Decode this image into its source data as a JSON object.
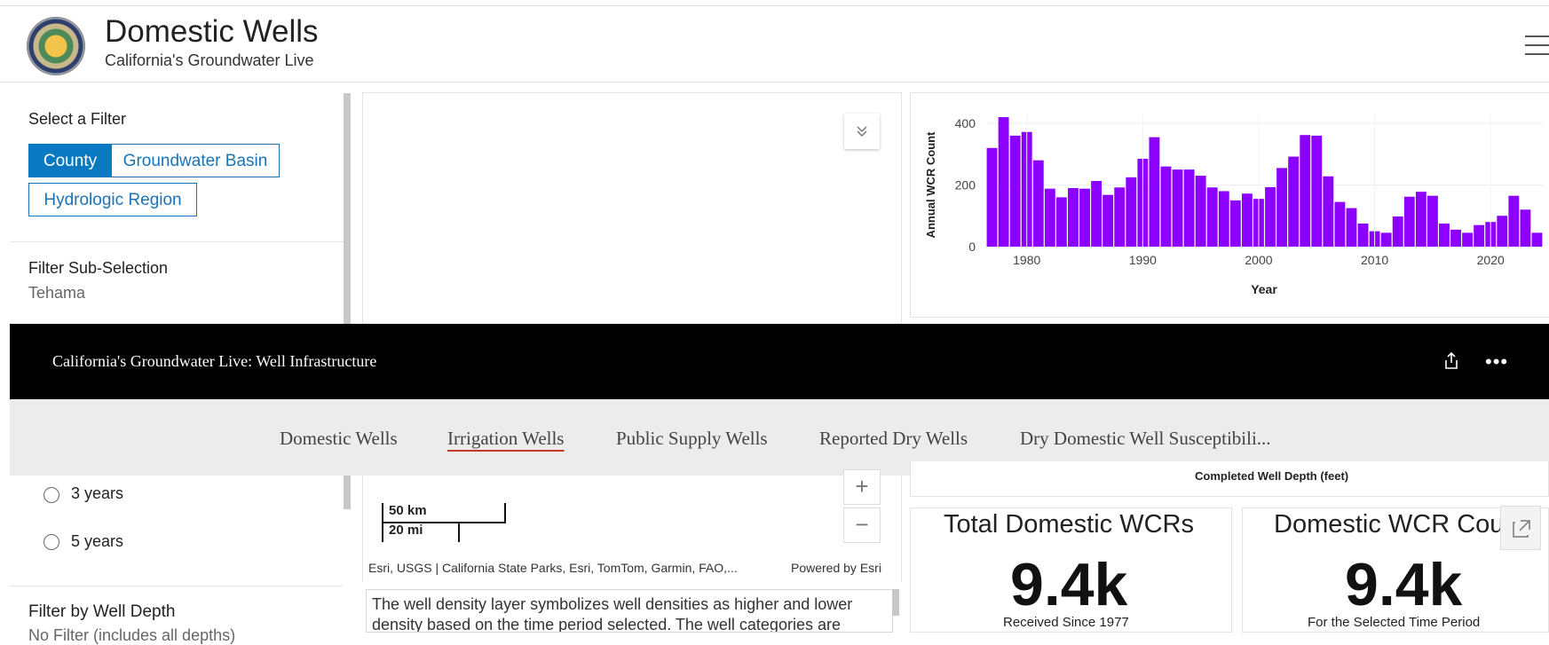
{
  "header": {
    "title": "Domestic Wells",
    "subtitle": "California's Groundwater Live"
  },
  "filter": {
    "label": "Select a Filter",
    "buttons": [
      "County",
      "Groundwater Basin",
      "Hydrologic Region"
    ],
    "active": "County",
    "subselection_label": "Filter Sub-Selection",
    "subselection_value": "Tehama"
  },
  "time_options": [
    "3 years",
    "5 years"
  ],
  "depth_filter": {
    "label": "Filter by Well Depth",
    "value": "No Filter (includes all depths)"
  },
  "app_bar": {
    "title": "California's Groundwater Live: Well Infrastructure"
  },
  "tabs": [
    {
      "label": "Domestic Wells"
    },
    {
      "label": "Irrigation Wells"
    },
    {
      "label": "Public Supply Wells"
    },
    {
      "label": "Reported Dry Wells"
    },
    {
      "label": "Dry Domestic Well Susceptibili..."
    }
  ],
  "active_tab": "Irrigation Wells",
  "map": {
    "scale_km": "50 km",
    "scale_mi": "20 mi",
    "attribution": "Esri, USGS | California State Parks, Esri, TomTom, Garmin, FAO,...",
    "powered_by": "Powered by Esri",
    "description": "The well density layer symbolizes well densities as higher and lower density based on the time period selected. The well categories are"
  },
  "depth_chart_axis_title": "Completed Well Depth (feet)",
  "cards": [
    {
      "title": "Total Domestic WCRs",
      "value": "9.4k",
      "subtitle": "Received Since 1977"
    },
    {
      "title": "Domestic WCR Cou",
      "value": "9.4k",
      "subtitle": "For the Selected Time Period"
    }
  ],
  "colors": {
    "accent": "#0b79c1",
    "bar": "#8b00ff",
    "tab_underline": "#c0392b"
  },
  "chart_data": {
    "type": "bar",
    "xlabel": "Year",
    "ylabel": "Annual WCR Count",
    "ylim": [
      0,
      400
    ],
    "xticks": [
      1980,
      1990,
      2000,
      2010,
      2020
    ],
    "yticks": [
      0,
      200,
      400
    ],
    "grid": true,
    "x": [
      1977,
      1978,
      1979,
      1980,
      1981,
      1982,
      1983,
      1984,
      1985,
      1986,
      1987,
      1988,
      1989,
      1990,
      1991,
      1992,
      1993,
      1994,
      1995,
      1996,
      1997,
      1998,
      1999,
      2000,
      2001,
      2002,
      2003,
      2004,
      2005,
      2006,
      2007,
      2008,
      2009,
      2010,
      2011,
      2012,
      2013,
      2014,
      2015,
      2016,
      2017,
      2018,
      2019,
      2020,
      2021,
      2022,
      2023,
      2024
    ],
    "values": [
      320,
      420,
      360,
      372,
      280,
      188,
      160,
      190,
      188,
      213,
      168,
      192,
      225,
      285,
      355,
      260,
      250,
      250,
      230,
      192,
      180,
      150,
      172,
      155,
      193,
      255,
      292,
      362,
      360,
      228,
      145,
      125,
      75,
      50,
      45,
      98,
      162,
      178,
      165,
      75,
      55,
      45,
      70,
      80,
      100,
      165,
      120,
      45
    ]
  }
}
